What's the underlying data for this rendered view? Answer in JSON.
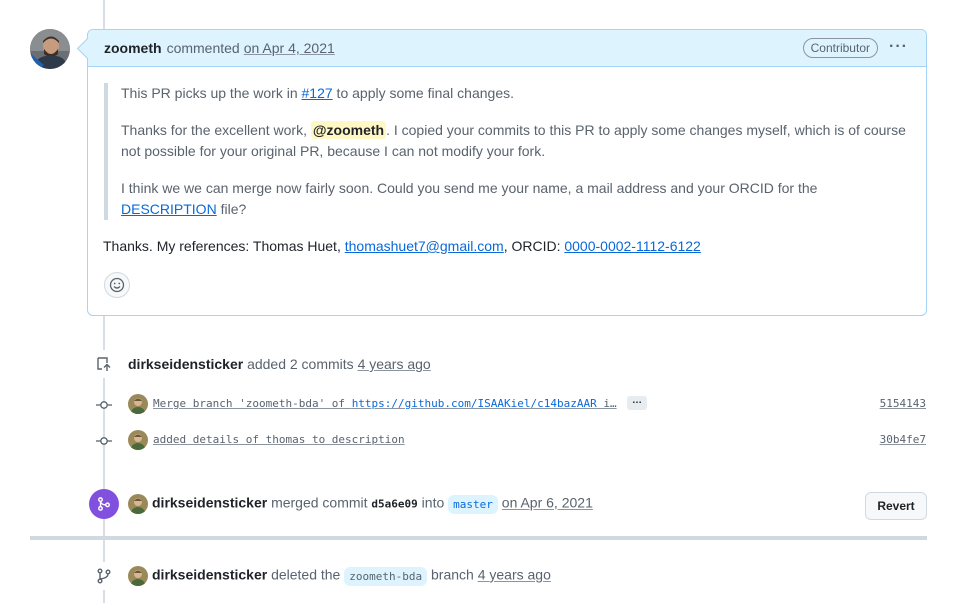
{
  "comment": {
    "author": "zoometh",
    "action": "commented",
    "date": "on Apr 4, 2021",
    "badge": "Contributor",
    "menu_icon": "kebab-horizontal-icon",
    "quote": {
      "p1_before": "This PR picks up the work in ",
      "p1_link": "#127",
      "p1_after": " to apply some final changes.",
      "p2_before": "Thanks for the excellent work, ",
      "p2_mention": "@zoometh",
      "p2_after": ". I copied your commits to this PR to apply some changes myself, which is of course not possible for your original PR, because I can not modify your fork.",
      "p3_before": "I think we we can merge now fairly soon. Could you send me your name, a mail address and your ORCID for the ",
      "p3_link": "DESCRIPTION",
      "p3_after": " file?"
    },
    "body": {
      "before": "Thanks. My references: Thomas Huet, ",
      "email": "thomashuet7@gmail.com",
      "middle": ", ORCID: ",
      "orcid": "0000-0002-1112-6122"
    },
    "reaction_icon": "smiley-icon"
  },
  "commits_event": {
    "actor": "dirkseidensticker",
    "text": "added 2 commits",
    "time": "4 years ago",
    "icon": "repo-push-icon"
  },
  "commits": [
    {
      "message": "Merge branch 'zoometh-bda' of ",
      "url": "https://github.com/ISAAKiel/c14bazAAR",
      "trail": " i…",
      "has_more": true,
      "more_label": "…",
      "sha": "5154143"
    },
    {
      "message": "added details of thomas to description",
      "url": "",
      "trail": "",
      "has_more": false,
      "more_label": "",
      "sha": "30b4fe7"
    }
  ],
  "merge_event": {
    "actor": "dirkseidensticker",
    "text1": "merged commit",
    "commit": "d5a6e09",
    "text2": "into",
    "branch": "master",
    "date": "on Apr 6, 2021",
    "revert_label": "Revert",
    "icon": "git-merge-icon"
  },
  "delete_event": {
    "actor": "dirkseidensticker",
    "text1": "deleted the",
    "branch": "zoometh-bda",
    "text2": "branch",
    "time": "4 years ago",
    "icon": "git-branch-icon"
  },
  "colors": {
    "accent": "#0969da",
    "merged": "#8250df",
    "header_bg": "#ddf4ff",
    "mention_bg": "#fff8c5"
  }
}
